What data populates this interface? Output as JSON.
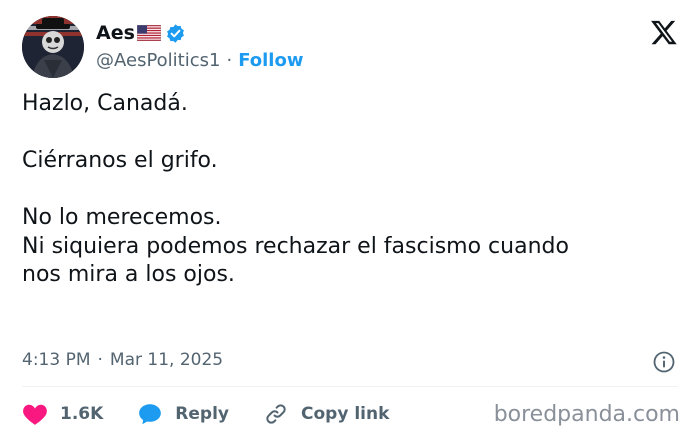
{
  "author": {
    "name": "Aes",
    "handle": "@AesPolitics1",
    "follow_label": "Follow",
    "separator": "·"
  },
  "tweet": {
    "lines": [
      "Hazlo, Canadá.",
      "Ciérranos el grifo.",
      "No lo merecemos.",
      "Ni siquiera podemos rechazar el fascismo cuando",
      "nos mira a los ojos."
    ]
  },
  "meta": {
    "time": "4:13 PM",
    "separator": "·",
    "date": "Mar 11, 2025"
  },
  "actions": {
    "likes_count": "1.6K",
    "reply_label": "Reply",
    "copy_link_label": "Copy link"
  },
  "watermark": "boredpanda.com",
  "icons": {
    "flag": "us-flag-icon",
    "verified": "verified-badge-icon",
    "platform": "x-logo-icon",
    "info": "info-icon",
    "like": "heart-icon",
    "reply": "speech-bubble-icon",
    "link": "link-icon"
  },
  "colors": {
    "text": "#0f1419",
    "secondary": "#536471",
    "accent": "#1d9bf0",
    "heart": "#f91880"
  }
}
